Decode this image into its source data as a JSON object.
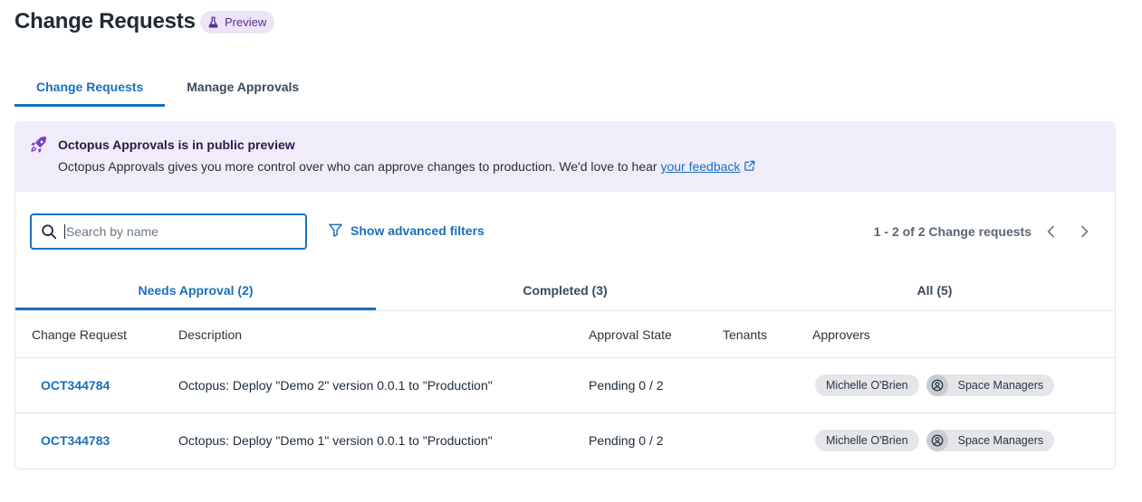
{
  "header": {
    "title": "Change Requests",
    "badge": "Preview"
  },
  "top_tabs": [
    {
      "label": "Change Requests",
      "active": true
    },
    {
      "label": "Manage Approvals",
      "active": false
    }
  ],
  "banner": {
    "title": "Octopus Approvals is in public preview",
    "text": "Octopus Approvals gives you more control over who can approve changes to production. We'd love to hear ",
    "link": "your feedback",
    "icon": "rocket-icon"
  },
  "toolbar": {
    "search_placeholder": "Search by name",
    "search_value": "",
    "filters_label": "Show advanced filters",
    "pager_text": "1 - 2 of 2 Change requests"
  },
  "sub_tabs": [
    {
      "label": "Needs Approval (2)",
      "active": true
    },
    {
      "label": "Completed (3)",
      "active": false
    },
    {
      "label": "All (5)",
      "active": false
    }
  ],
  "table": {
    "columns": [
      "Change Request",
      "Description",
      "Approval State",
      "Tenants",
      "Approvers"
    ],
    "rows": [
      {
        "id": "OCT344784",
        "description": "Octopus: Deploy \"Demo 2\" version 0.0.1 to \"Production\"",
        "state": "Pending 0 / 2",
        "tenants": "",
        "approver_user": "Michelle O'Brien",
        "approver_team": "Space Managers"
      },
      {
        "id": "OCT344783",
        "description": "Octopus: Deploy \"Demo 1\" version 0.0.1 to \"Production\"",
        "state": "Pending 0 / 2",
        "tenants": "",
        "approver_user": "Michelle O'Brien",
        "approver_team": "Space Managers"
      }
    ]
  },
  "colors": {
    "accent": "#1a6fbe",
    "banner_bg": "#f1ecfa",
    "badge_bg": "#ece4f7",
    "badge_text": "#5b2f93"
  }
}
